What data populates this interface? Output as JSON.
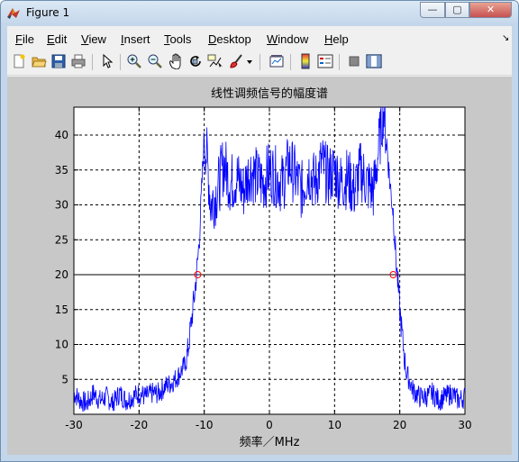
{
  "window": {
    "title": "Figure 1",
    "min_label": "—",
    "max_label": "▢",
    "close_label": "✕"
  },
  "menu": [
    "File",
    "Edit",
    "View",
    "Insert",
    "Tools",
    "Desktop",
    "Window",
    "Help"
  ],
  "menu_underline": [
    "F",
    "E",
    "V",
    "I",
    "T",
    "D",
    "W",
    "H"
  ],
  "toolbar_icons": [
    "new-figure-icon",
    "open-file-icon",
    "save-icon",
    "print-icon",
    "edit-plot-arrow-icon",
    "zoom-in-icon",
    "zoom-out-icon",
    "pan-hand-icon",
    "rotate-3d-icon",
    "data-cursor-icon",
    "brush-icon",
    "brush-dropdown-icon",
    "link-plot-icon",
    "colorbar-icon",
    "legend-icon",
    "hide-plot-tools-icon",
    "show-plot-tools-icon"
  ],
  "chart_data": {
    "type": "line",
    "title": "线性调频信号的幅度谱",
    "xlabel": "频率／MHz",
    "ylabel": "",
    "xlim": [
      -30,
      30
    ],
    "ylim": [
      0,
      44
    ],
    "xticks": [
      -30,
      -20,
      -10,
      0,
      10,
      20,
      30
    ],
    "yticks": [
      5,
      10,
      15,
      20,
      25,
      30,
      35,
      40
    ],
    "grid": true,
    "series_color": "#0000ff",
    "reference_line": {
      "y": 20,
      "color": "#000000"
    },
    "markers": [
      {
        "x": -11,
        "y": 20
      },
      {
        "x": 19,
        "y": 20
      }
    ],
    "marker_color": "#ff0000",
    "series": [
      {
        "x": [
          -30,
          -29,
          -28,
          -27,
          -26,
          -25,
          -24,
          -23,
          -22,
          -21,
          -20,
          -19,
          -18,
          -17,
          -16,
          -15,
          -14,
          -13,
          -12.5,
          -12,
          -11.5,
          -11,
          -10.7,
          -10.4,
          -10,
          -9.5,
          -9,
          -8,
          -7,
          -6,
          -5,
          -4,
          -3,
          -2,
          -1,
          0,
          1,
          2,
          3,
          4,
          5,
          6,
          7,
          8,
          9,
          10,
          11,
          12,
          13,
          14,
          15,
          16,
          16.5,
          17,
          17.5,
          18,
          18.5,
          19,
          19.3,
          19.6,
          20,
          20.5,
          21,
          22,
          23,
          24,
          25,
          26,
          27,
          28,
          29,
          30
        ],
        "values": [
          3,
          2,
          1.5,
          3,
          2,
          2.5,
          1.5,
          3,
          2,
          2.5,
          3,
          2.5,
          3,
          3,
          4,
          4.5,
          5.5,
          7,
          9,
          13,
          17,
          22,
          26,
          32,
          40,
          36,
          30,
          32,
          36,
          33,
          34,
          32,
          35,
          34,
          33,
          35,
          34,
          33,
          36,
          34,
          32,
          35,
          33,
          36,
          34,
          35,
          33,
          34,
          32,
          35,
          33,
          32,
          36,
          40,
          44,
          39,
          33,
          29,
          24,
          20,
          15,
          10,
          6,
          3.5,
          2.5,
          2.5,
          3,
          2,
          2.5,
          3,
          2,
          2.5
        ]
      }
    ]
  }
}
